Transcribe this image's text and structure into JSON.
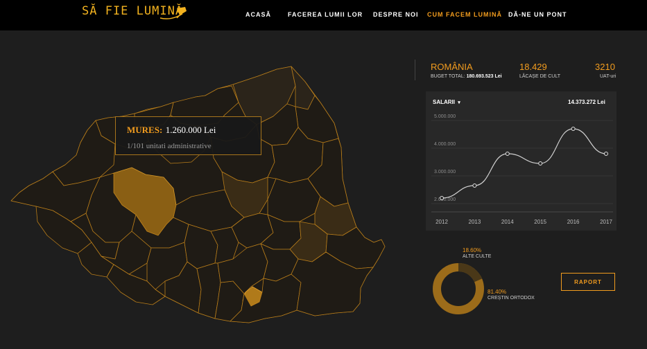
{
  "brand": {
    "name": "SĂ FIE LUMINĂ"
  },
  "nav": [
    "ACASĂ",
    "FACEREA LUMII LOR",
    "DESPRE NOI",
    "CUM FACEM LUMINĂ",
    "DĂ-NE UN PONT"
  ],
  "nav_active": 3,
  "tooltip": {
    "county": "MURES:",
    "amount": "1.260.000 Lei",
    "units": "1/101 unitati administrative"
  },
  "summary": {
    "country": "ROMÂNIA",
    "budget_label": "BUGET TOTAL:",
    "budget_value": "180.693.523 Lei",
    "churches_value": "18.429",
    "churches_label": "LĂCAȘE DE CULT",
    "uat_value": "3210",
    "uat_label": "UAT-uri"
  },
  "chart_panel": {
    "selector": "SALARII",
    "total": "14.373.272 Lei"
  },
  "chart_data": {
    "type": "line",
    "x": [
      2012,
      2013,
      2014,
      2015,
      2016,
      2017
    ],
    "values": [
      2200000,
      2650000,
      3800000,
      3450000,
      4700000,
      3800000
    ],
    "ylim": [
      1700000,
      5100000
    ],
    "yticks": [
      "2.000.000",
      "3.000.000",
      "4.000.000",
      "5.000.000"
    ],
    "ytick_values": [
      2000000,
      3000000,
      4000000,
      5000000
    ],
    "xticks": [
      "2012",
      "2013",
      "2014",
      "2015",
      "2016",
      "2017"
    ],
    "grid": true
  },
  "distribution": {
    "other_pct": "18.60%",
    "other_label": "ALTE CULTE",
    "other_value": 18.6,
    "orthodox_pct": "81.40%",
    "orthodox_label": "CREȘTIN ORTODOX",
    "orthodox_value": 81.4
  },
  "report_button": "RAPORT",
  "colors": {
    "accent": "#f29c1e",
    "background": "#1e1e1e",
    "card": "#282828",
    "highlight": "#8a5f14",
    "border": "#c8871a"
  }
}
